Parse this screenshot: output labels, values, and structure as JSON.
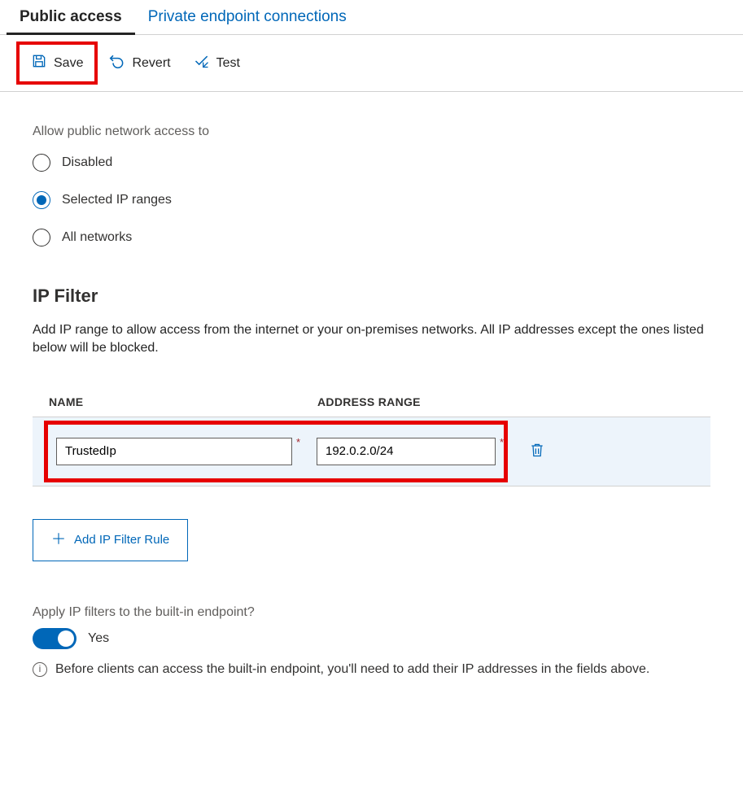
{
  "tabs": {
    "public": "Public access",
    "private": "Private endpoint connections"
  },
  "toolbar": {
    "save": "Save",
    "revert": "Revert",
    "test": "Test"
  },
  "access": {
    "label": "Allow public network access to",
    "options": {
      "disabled": "Disabled",
      "selected_ip": "Selected IP ranges",
      "all": "All networks"
    }
  },
  "ipfilter": {
    "heading": "IP Filter",
    "description": "Add IP range to allow access from the internet or your on-premises networks. All IP addresses except the ones listed below will be blocked.",
    "columns": {
      "name": "NAME",
      "address_range": "ADDRESS RANGE"
    },
    "rows": [
      {
        "name": "TrustedIp",
        "address_range": "192.0.2.0/24"
      }
    ],
    "add_button": "Add IP Filter Rule"
  },
  "builtin": {
    "label": "Apply IP filters to the built-in endpoint?",
    "toggle_value": "Yes",
    "info": "Before clients can access the built-in endpoint, you'll need to add their IP addresses in the fields above."
  }
}
